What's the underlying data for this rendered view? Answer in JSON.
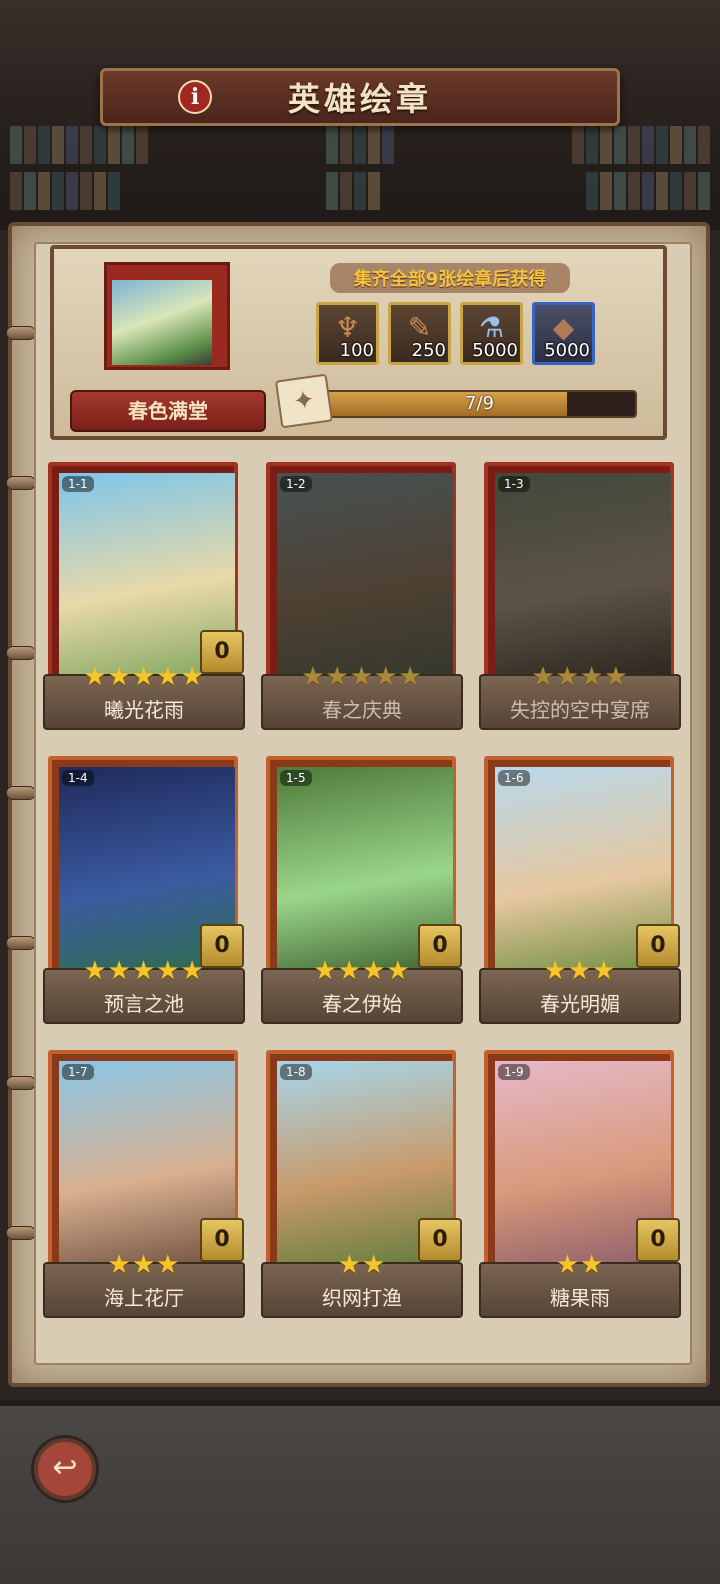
{
  "header": {
    "title": "英雄绘章",
    "info_icon": "info-icon"
  },
  "reward": {
    "caption": "集齐全部9张绘章后获得",
    "name": "春色满堂",
    "items": [
      {
        "icon": "horn-icon",
        "qty": "100"
      },
      {
        "icon": "scroll-icon",
        "qty": "250"
      },
      {
        "icon": "potion-icon",
        "qty": "5000"
      },
      {
        "icon": "ore-icon",
        "qty": "5000"
      }
    ],
    "progress_text": "7/9",
    "progress_fraction": 0.78
  },
  "cards": [
    {
      "num": "1-1",
      "name": "曦光花雨",
      "stars": "★★★★★",
      "count": "0",
      "art": [
        "#7dc5ea",
        "#e8d9a8",
        "#7aa35a"
      ]
    },
    {
      "num": "1-2",
      "name": "春之庆典",
      "stars": "★★★★★",
      "count": "",
      "art": [
        "#6f8a8a",
        "#8a6a4a",
        "#4f5f3f"
      ]
    },
    {
      "num": "1-3",
      "name": "失控的空中宴席",
      "stars": "★★★★",
      "count": "",
      "art": [
        "#6a7a5a",
        "#a08a6a",
        "#4a3a2a"
      ]
    },
    {
      "num": "1-4",
      "name": "预言之池",
      "stars": "★★★★★",
      "count": "0",
      "art": [
        "#1f2a5a",
        "#3a5aa0",
        "#2f6f4a"
      ]
    },
    {
      "num": "1-5",
      "name": "春之伊始",
      "stars": "★★★★",
      "count": "0",
      "art": [
        "#4f7a3a",
        "#9ad68a",
        "#3a5a2a"
      ]
    },
    {
      "num": "1-6",
      "name": "春光明媚",
      "stars": "★★★",
      "count": "0",
      "art": [
        "#b8d8ea",
        "#e6c8a0",
        "#6a8a3a"
      ]
    },
    {
      "num": "1-7",
      "name": "海上花厅",
      "stars": "★★★",
      "count": "0",
      "art": [
        "#8ac6e6",
        "#d8b090",
        "#6a4a3a"
      ]
    },
    {
      "num": "1-8",
      "name": "织网打渔",
      "stars": "★★",
      "count": "0",
      "art": [
        "#a6d6ea",
        "#c89a6a",
        "#5a7a3a"
      ]
    },
    {
      "num": "1-9",
      "name": "糖果雨",
      "stars": "★★",
      "count": "0",
      "art": [
        "#e6b8c8",
        "#d89a7a",
        "#8a5a6a"
      ]
    }
  ],
  "bottom": {
    "back_icon": "back-arrow-icon",
    "back_glyph": "↩"
  },
  "colors": {
    "gold": "#f5c52a",
    "plate": "#6a5443",
    "parchment": "#d9ccb4"
  }
}
